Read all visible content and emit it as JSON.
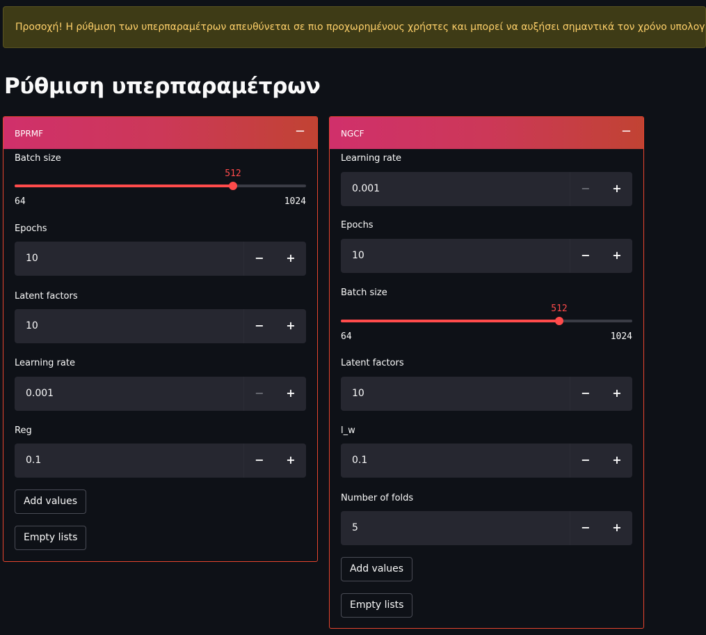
{
  "warning": "Προσοχή! Η ρύθμιση των υπερπαραμέτρων απευθύνεται σε πιο προχωρημένους χρήστες και μπορεί να αυξήσει σημαντικά τον χρόνο υπολογισμού.",
  "title": "Ρύθμιση υπερπαραμέτρων",
  "icons": {
    "collapse": "minus-icon",
    "decrement": "minus-icon",
    "increment": "plus-icon"
  },
  "colors": {
    "accent": "#ff4b4b",
    "panel_border": "#e8452e",
    "warning_bg": "#3e3b16",
    "warning_text": "#ffd16a",
    "header_gradient_start": "#d0306b",
    "header_gradient_end": "#c14333"
  },
  "bprmf": {
    "title": "BPRMF",
    "collapse": "−",
    "batch_size": {
      "label": "Batch size",
      "value": "512",
      "min": "64",
      "max": "1024",
      "fraction": 0.75
    },
    "epochs": {
      "label": "Epochs",
      "value": "10"
    },
    "latent_factors": {
      "label": "Latent factors",
      "value": "10"
    },
    "learning_rate": {
      "label": "Learning rate",
      "value": "0.001"
    },
    "reg": {
      "label": "Reg",
      "value": "0.1"
    },
    "add_values": "Add values",
    "empty_lists": "Empty lists"
  },
  "ngcf": {
    "title": "NGCF",
    "collapse": "−",
    "learning_rate": {
      "label": "Learning rate",
      "value": "0.001"
    },
    "epochs": {
      "label": "Epochs",
      "value": "10"
    },
    "batch_size": {
      "label": "Batch size",
      "value": "512",
      "min": "64",
      "max": "1024",
      "fraction": 0.75
    },
    "latent_factors": {
      "label": "Latent factors",
      "value": "10"
    },
    "l_w": {
      "label": "l_w",
      "value": "0.1"
    },
    "folds": {
      "label": "Number of folds",
      "value": "5"
    },
    "add_values": "Add values",
    "empty_lists": "Empty lists"
  },
  "stepper": {
    "minus": "−",
    "plus": "+"
  }
}
